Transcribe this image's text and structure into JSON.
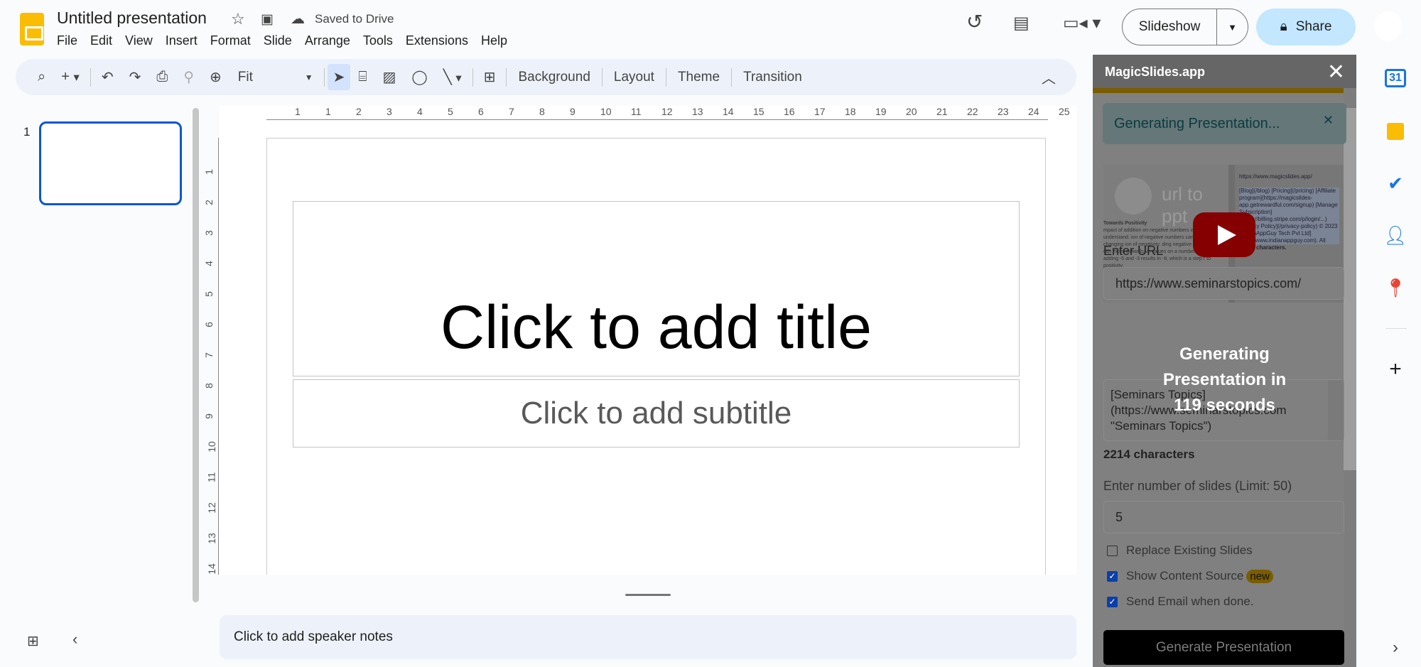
{
  "header": {
    "title": "Untitled presentation",
    "saved_status": "Saved to Drive",
    "slideshow_label": "Slideshow",
    "share_label": "Share"
  },
  "menu": [
    "File",
    "Edit",
    "View",
    "Insert",
    "Format",
    "Slide",
    "Arrange",
    "Tools",
    "Extensions",
    "Help"
  ],
  "toolbar": {
    "zoom_value": "Fit",
    "background": "Background",
    "layout": "Layout",
    "theme": "Theme",
    "transition": "Transition"
  },
  "filmstrip": {
    "slide_number": "1"
  },
  "ruler": {
    "horizontal": [
      "1",
      "1",
      "2",
      "3",
      "4",
      "5",
      "6",
      "7",
      "8",
      "9",
      "10",
      "11",
      "12",
      "13",
      "14",
      "15",
      "16",
      "17",
      "18",
      "19",
      "20",
      "21",
      "22",
      "23",
      "24",
      "25"
    ],
    "vertical": [
      "1",
      "2",
      "3",
      "4",
      "5",
      "6",
      "7",
      "8",
      "9",
      "10",
      "11",
      "12",
      "13",
      "14"
    ]
  },
  "slide": {
    "title_placeholder": "Click to add title",
    "subtitle_placeholder": "Click to add subtitle"
  },
  "notes": {
    "placeholder": "Click to add speaker notes"
  },
  "panel": {
    "title": "MagicSlides.app",
    "alert": "Generating Presentation...",
    "video": {
      "title": "url to ppt",
      "left_heading": "Towards Positivity",
      "left_text": "mpact of addition on negative numbers is a c... pt to understand. ion of negative numbers can help in changing ion of negativity. ding negative numbers, we can move towards ve values on a number line. xample, adding -5 and -3 results in -8, which is a step r to positivity.",
      "right_url": "https://www.magicslides.app/",
      "right_text": "[Blog](/blog) [Pricing](/pricing) [Affiliate program](https://magicslides-app.getrewardful.com/signup) [Manage Subscription](https://billing.stripe.com/p/login/...) [Privacy Policy](/privacy-policy) © 2023 [IndianAppGuy Tech Pvt Ltd](http://www.indianappguy.com). All",
      "right_count": "11740 characters."
    },
    "url_label": "Enter URL",
    "url_value": "https://www.seminarstopics.com/",
    "content_text": "[Seminars Topics]\n(https://www.seminarstopics.com\n\"Seminars Topics\")",
    "char_count": "2214 characters",
    "slides_label": "Enter number of slides (Limit: 50)",
    "slides_value": "5",
    "options": [
      {
        "label": "Replace Existing Slides",
        "checked": false
      },
      {
        "label": "Show Content Source",
        "checked": true,
        "badge": "new"
      },
      {
        "label": "Send Email when done.",
        "checked": true
      }
    ],
    "generate_label": "Generate Presentation",
    "overlay": {
      "line1": "Generating",
      "line2": "Presentation in",
      "line3": "119 seconds"
    }
  },
  "colors": {
    "accent": "#0b57d0",
    "share_bg": "#c2e7ff",
    "toolbar_bg": "#edf2fa"
  }
}
